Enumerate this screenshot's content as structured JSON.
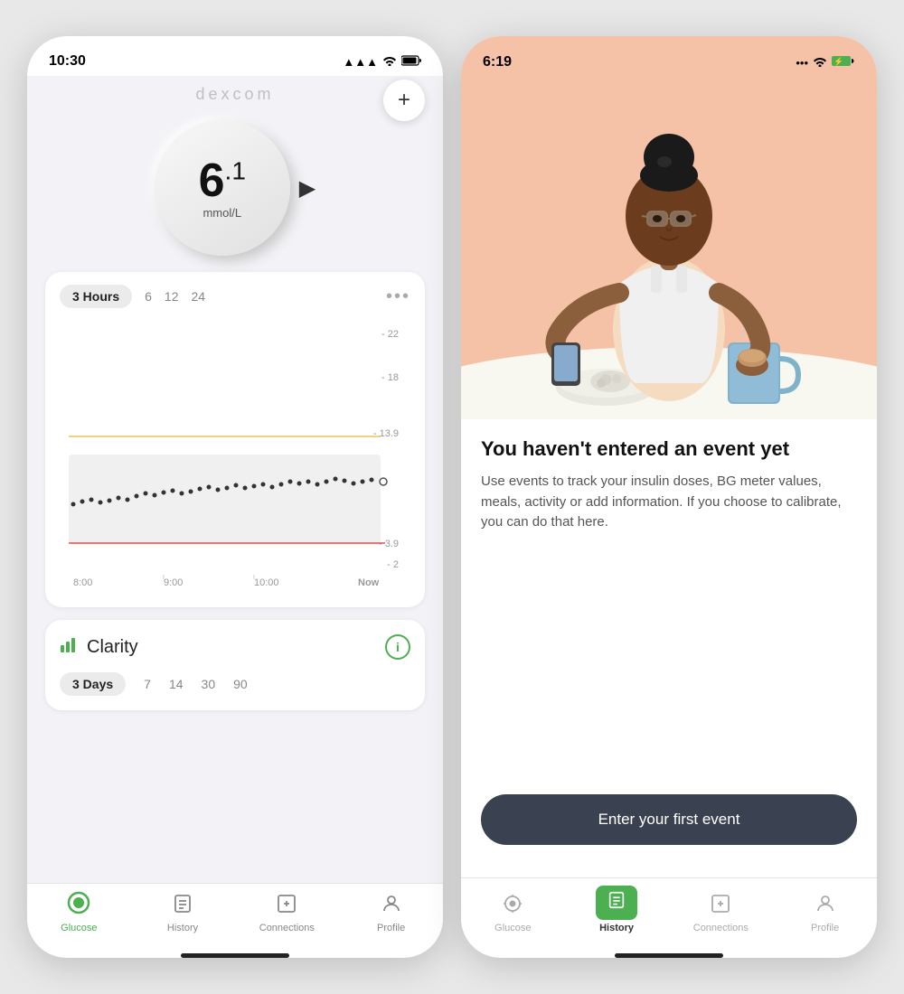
{
  "screen1": {
    "statusBar": {
      "time": "10:30",
      "signal": "▲▲▲",
      "wifi": "WiFi",
      "battery": "🔋"
    },
    "brand": "Dexcom",
    "addButton": "+",
    "glucose": {
      "value": "6",
      "decimal": ".1",
      "unit": "mmol/L",
      "arrow": "▶"
    },
    "chartTabs": [
      "3 Hours",
      "6",
      "12",
      "24"
    ],
    "chartActiveTab": 0,
    "chartMoreLabel": "•••",
    "chartYLabels": [
      "- 22",
      "- 18",
      "- 13.9",
      "- 3.9",
      "- 2"
    ],
    "chartXLabels": [
      "8:00",
      "9:00",
      "10:00",
      "Now"
    ],
    "clarity": {
      "title": "Clarity",
      "infoLabel": "i",
      "tabs": [
        "3 Days",
        "7",
        "14",
        "30",
        "90"
      ],
      "activeTab": 0
    },
    "bottomNav": [
      {
        "icon": "glucose-circle",
        "label": "Glucose",
        "active": true
      },
      {
        "icon": "history-list",
        "label": "History",
        "active": false
      },
      {
        "icon": "connections-door",
        "label": "Connections",
        "active": false
      },
      {
        "icon": "profile-person",
        "label": "Profile",
        "active": false
      }
    ]
  },
  "screen2": {
    "statusBar": {
      "time": "6:19",
      "dots": "•••",
      "wifi": "WiFi",
      "battery": "⚡"
    },
    "emptyTitle": "You haven't entered an event yet",
    "emptyDesc": "Use events to track your insulin doses, BG meter values, meals, activity or add information. If you choose to calibrate, you can do that here.",
    "enterEventBtn": "Enter your first event",
    "bottomNav": [
      {
        "icon": "glucose-eye",
        "label": "Glucose",
        "active": false
      },
      {
        "icon": "history-list",
        "label": "History",
        "active": true
      },
      {
        "icon": "connections-door",
        "label": "Connections",
        "active": false
      },
      {
        "icon": "profile-person",
        "label": "Profile",
        "active": false
      }
    ]
  }
}
